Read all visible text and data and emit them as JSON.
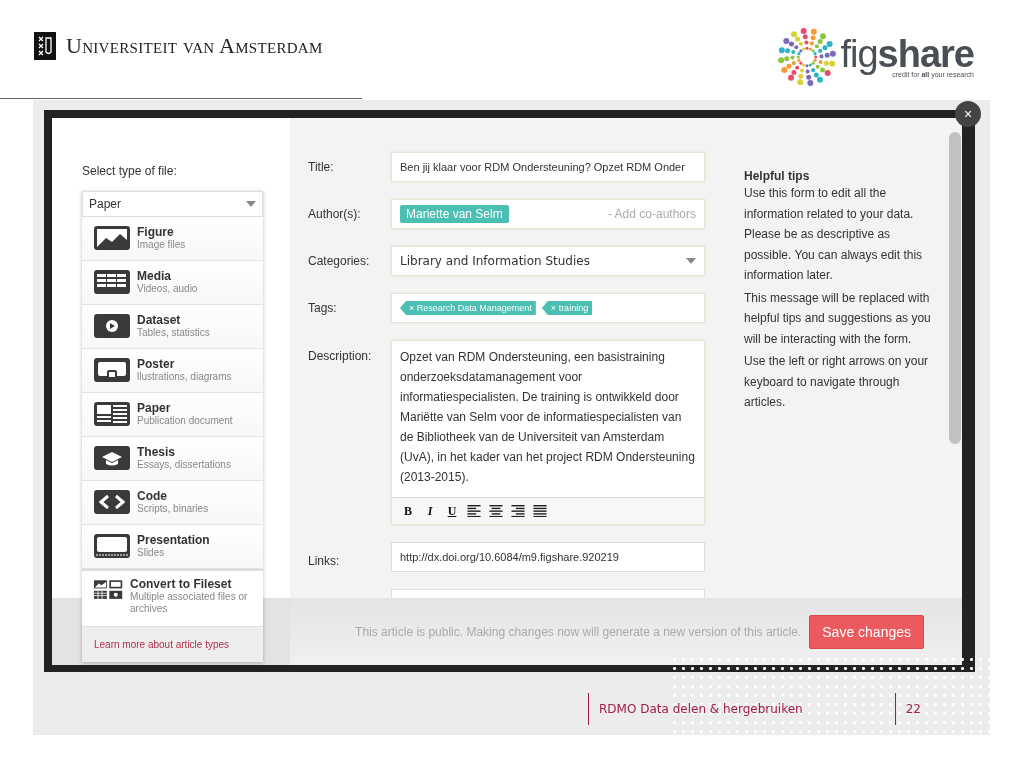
{
  "slide_header": {
    "university": "Universiteit van Amsterdam",
    "brand": "fig**share**",
    "tagline": "credit for **all** your research"
  },
  "modal": {
    "close": "×",
    "file_type": {
      "label": "Select type of file:",
      "value": "Paper",
      "types": [
        {
          "kind": "figure",
          "name": "Figure",
          "description": "Image files"
        },
        {
          "kind": "media",
          "name": "Media",
          "description": "Videos, audio"
        },
        {
          "kind": "dataset",
          "name": "Dataset",
          "description": "Tables, statistics"
        },
        {
          "kind": "poster",
          "name": "Poster",
          "description": "llustrations, diagrams"
        },
        {
          "kind": "paper",
          "name": "Paper",
          "description": "Publication document"
        },
        {
          "kind": "thesis",
          "name": "Thesis",
          "description": "Essays, dissertations"
        },
        {
          "kind": "code",
          "name": "Code",
          "description": "Scripts, binaries"
        },
        {
          "kind": "presentation",
          "name": "Presentation",
          "description": "Slides"
        },
        {
          "kind": "fileset",
          "name": "Convert to Fileset",
          "description": "Multiple associated files or archives"
        }
      ],
      "learn_more": "Learn more about article types"
    },
    "form": [
      {
        "kind": "text",
        "label": "Title:",
        "value": "Ben jij klaar voor RDM Ondersteuning? Opzet RDM Onder"
      },
      {
        "kind": "authors",
        "label": "Author(s):",
        "chips": [
          "Mariette van Selm"
        ],
        "placeholder": "- Add co-authors"
      },
      {
        "kind": "select",
        "label": "Categories:",
        "value": "Library and Information Studies"
      },
      {
        "kind": "tags",
        "label": "Tags:",
        "remove_mark": "×",
        "chips": [
          "Research Data Management",
          "training"
        ]
      },
      {
        "kind": "description",
        "label": "Description:",
        "value": "Opzet van RDM Ondersteuning, een basistraining onderzoeksdatamanagement voor informatiespecialisten. De training is ontwikkeld door Mariëtte van Selm voor de informatiespecialisten van de Bibliotheek van de Universiteit van Amsterdam (UvA), in het kader van het project RDM Ondersteuning (2013-2015).",
        "format_buttons": [
          "B",
          "I",
          "U"
        ]
      },
      {
        "kind": "text",
        "label": "Links:",
        "value": "http://dx.doi.org/10.6084/m9.figshare.920219"
      },
      {
        "kind": "text"
      }
    ],
    "tips": {
      "title": "Helpful tips",
      "paragraphs": [
        "Use this form to edit all the information related to your data. Please be as descriptive as possible. You can always edit this information later.",
        "This message will be replaced with helpful tips and suggestions as you will be interacting with the form.",
        "Use the left or right arrows on your keyboard to navigate through articles."
      ]
    },
    "notice": "This article is public. Making changes now will generate a new version of this article.",
    "save": "Save changes"
  },
  "slide_footer": {
    "title": "RDMO Data delen & hergebruiken",
    "page": "22"
  }
}
